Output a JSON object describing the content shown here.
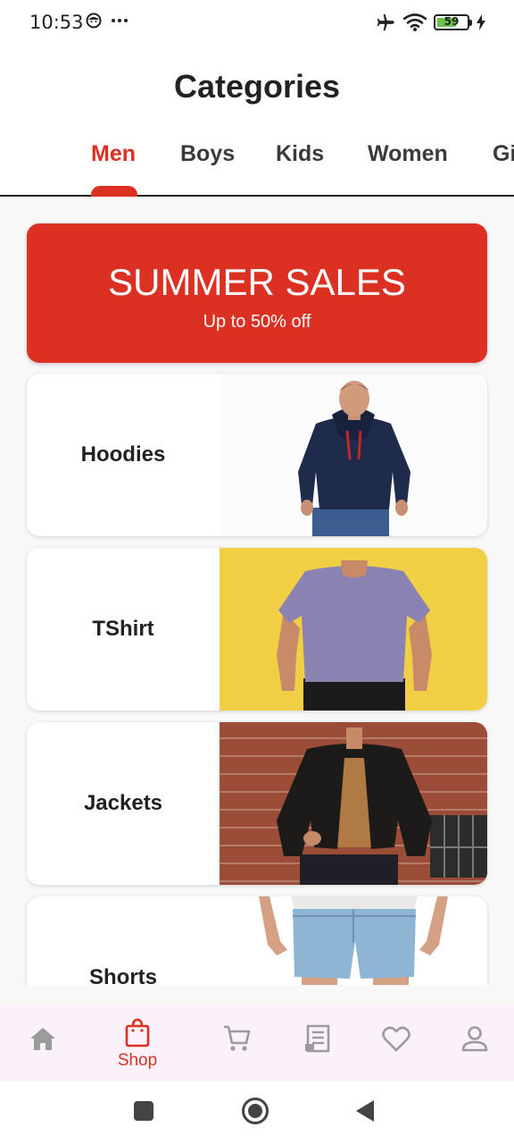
{
  "status_bar": {
    "time": "10:53",
    "battery_level": "59",
    "icons": [
      "face-icon",
      "more-dots-icon",
      "airplane-icon",
      "wifi-icon",
      "battery-icon",
      "charging-bolt-icon"
    ]
  },
  "header": {
    "title": "Categories"
  },
  "tabs": [
    {
      "label": "Men",
      "active": true
    },
    {
      "label": "Boys",
      "active": false
    },
    {
      "label": "Kids",
      "active": false
    },
    {
      "label": "Women",
      "active": false
    },
    {
      "label": "Gi",
      "active": false
    }
  ],
  "promo": {
    "title": "SUMMER SALES",
    "subtitle": "Up to 50% off"
  },
  "categories": [
    {
      "label": "Hoodies",
      "image": "navy hoodie model photo"
    },
    {
      "label": "TShirt",
      "image": "lavender t-shirt model photo"
    },
    {
      "label": "Jackets",
      "image": "leather jacket model photo"
    },
    {
      "label": "Shorts",
      "image": "denim shorts model photo"
    }
  ],
  "bottom_nav": [
    {
      "icon": "home-icon",
      "label": ""
    },
    {
      "icon": "shopping-bag-icon",
      "label": "Shop",
      "active": true
    },
    {
      "icon": "cart-icon",
      "label": ""
    },
    {
      "icon": "receipt-icon",
      "label": ""
    },
    {
      "icon": "heart-icon",
      "label": ""
    },
    {
      "icon": "profile-icon",
      "label": ""
    }
  ],
  "colors": {
    "accent": "#db3022",
    "text": "#222222",
    "nav_background": "#fbf1fa",
    "inactive_icon": "#9b9b9b"
  }
}
